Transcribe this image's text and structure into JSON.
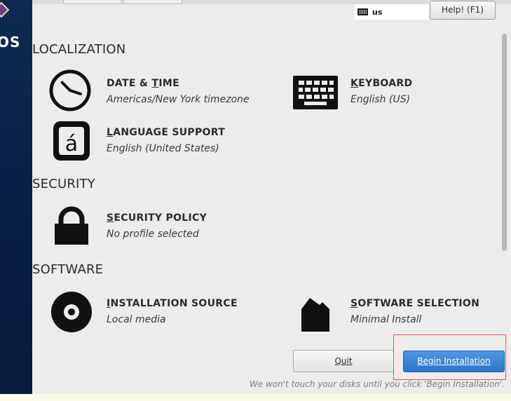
{
  "sidebar": {
    "logo_text": "OS"
  },
  "header": {
    "keyboard_layout": "us",
    "help_label": "Help! (F1)"
  },
  "sections": {
    "localization": "LOCALIZATION",
    "security": "SECURITY",
    "software": "SOFTWARE"
  },
  "spokes": {
    "date_time": {
      "mnemonic": "T",
      "title_pre": "DATE & ",
      "title_post": "IME",
      "status": "Americas/New York timezone"
    },
    "keyboard": {
      "mnemonic": "K",
      "title_post": "EYBOARD",
      "status": "English (US)"
    },
    "language_support": {
      "mnemonic": "L",
      "title_post": "ANGUAGE SUPPORT",
      "status": "English (United States)"
    },
    "security_policy": {
      "mnemonic": "S",
      "title_post": "ECURITY POLICY",
      "status": "No profile selected"
    },
    "installation_source": {
      "mnemonic": "I",
      "title_post": "NSTALLATION SOURCE",
      "status": "Local media"
    },
    "software_selection": {
      "mnemonic": "S",
      "title_post": "OFTWARE SELECTION",
      "status": "Minimal Install"
    }
  },
  "footer": {
    "quit_label": "Quit",
    "begin_label": "Begin Installation",
    "note": "We won't touch your disks until you click 'Begin Installation'."
  },
  "icons": {
    "clock": "clock-icon",
    "keyboard": "keyboard-icon",
    "language": "language-icon",
    "lock": "lock-icon",
    "disc": "disc-icon",
    "package": "package-icon"
  },
  "colors": {
    "accent": "#3a82d6",
    "highlight": "#e8545a",
    "sidebar": "#0b2148"
  }
}
